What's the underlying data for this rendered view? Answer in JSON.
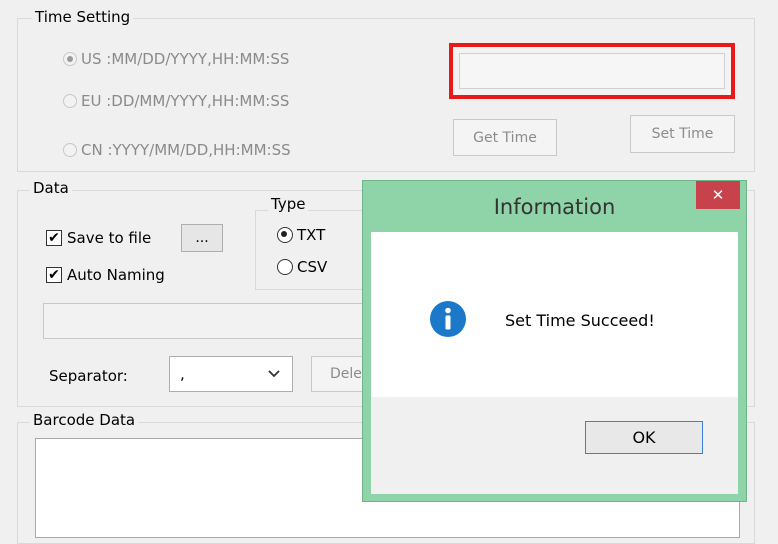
{
  "time_setting": {
    "title": "Time Setting",
    "options": [
      {
        "label": "US :MM/DD/YYYY,HH:MM:SS",
        "selected": true
      },
      {
        "label": "EU :DD/MM/YYYY,HH:MM:SS",
        "selected": false
      },
      {
        "label": "CN :YYYY/MM/DD,HH:MM:SS",
        "selected": false
      }
    ],
    "time_value": "",
    "get_time_label": "Get Time",
    "set_time_label": "Set Time"
  },
  "data": {
    "title": "Data",
    "save_to_file_label": "Save to file",
    "save_to_file_checked": true,
    "browse_label": "...",
    "auto_naming_label": "Auto Naming",
    "auto_naming_checked": true,
    "type_title": "Type",
    "type_txt_label": "TXT",
    "type_csv_label": "CSV",
    "path_value": "",
    "separator_label": "Separator:",
    "separator_value": ",",
    "delete_label": "Dele"
  },
  "barcode": {
    "title": "Barcode Data",
    "content": ""
  },
  "dialog": {
    "title": "Information",
    "message": "Set Time Succeed!",
    "ok_label": "OK",
    "close_glyph": "✕",
    "frame_color": "#8fd3a8",
    "close_color": "#c7424a",
    "info_icon_color": "#1c78c9"
  },
  "highlight_color": "#e8191b"
}
